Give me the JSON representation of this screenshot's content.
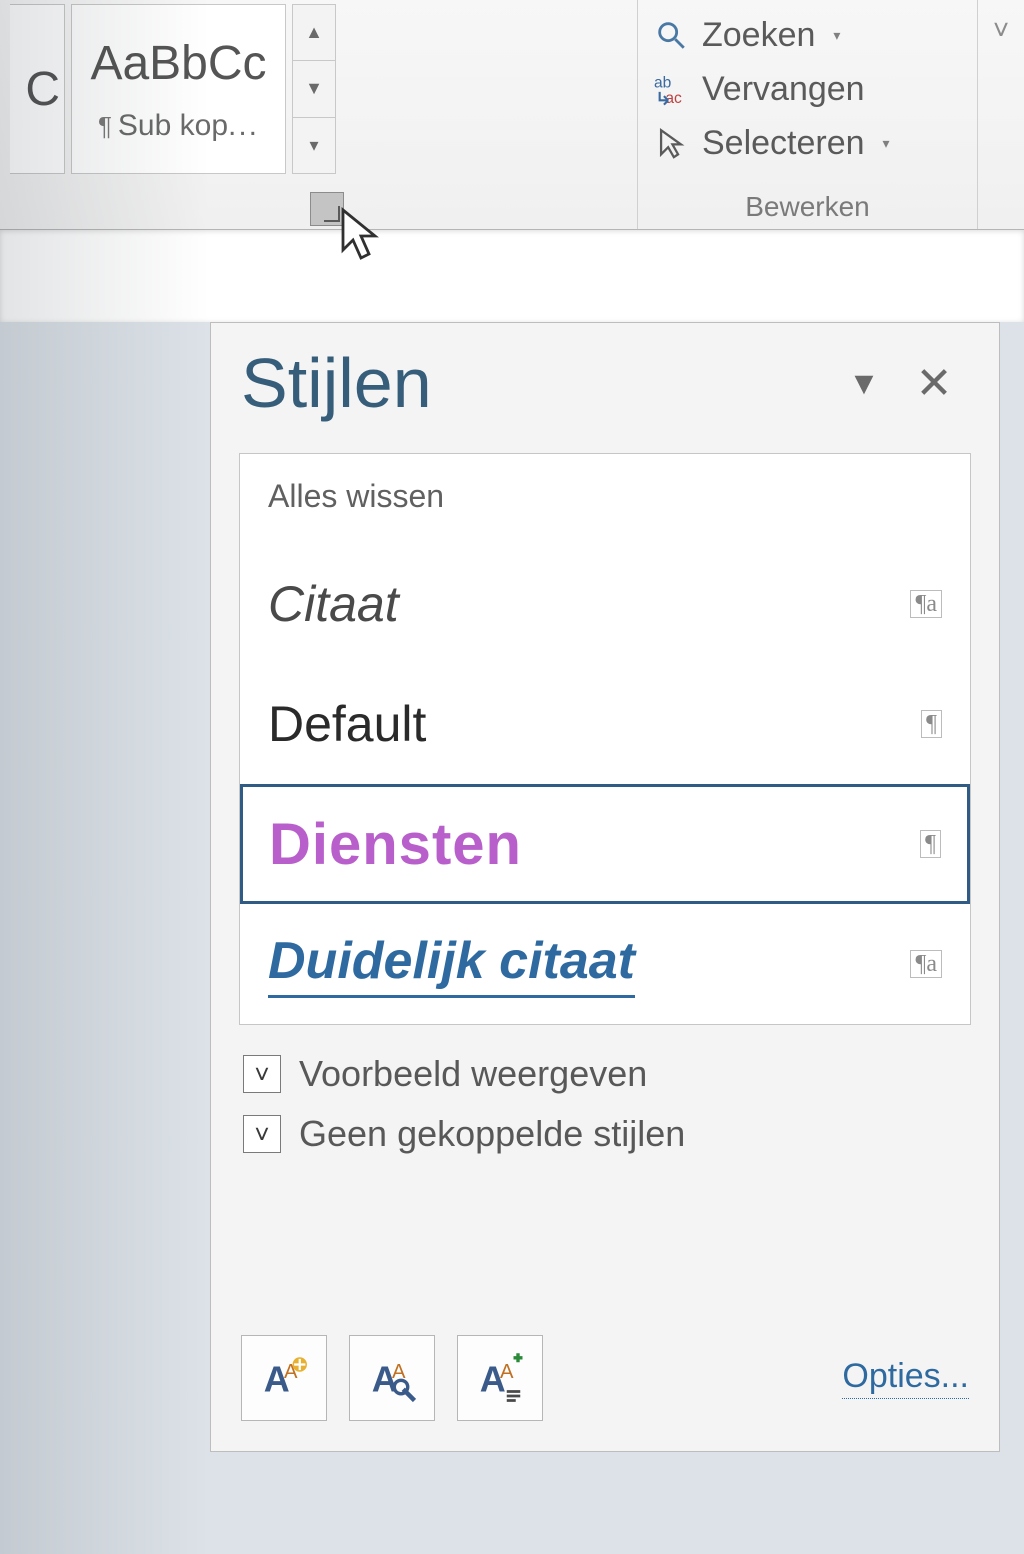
{
  "ribbon": {
    "gallery_preview_partial": "C",
    "gallery_preview_full": "AaBbCc",
    "gallery_style_label": "Sub kop",
    "gallery_ellipsis": "...",
    "editing": {
      "find": "Zoeken",
      "replace": "Vervangen",
      "select": "Selecteren",
      "caption": "Bewerken"
    }
  },
  "styles_pane": {
    "title": "Stijlen",
    "clear_all": "Alles wissen",
    "items": [
      {
        "name": "Citaat",
        "type_glyph": "¶a",
        "class": "citaat"
      },
      {
        "name": "Default",
        "type_glyph": "¶",
        "class": "default"
      },
      {
        "name": "Diensten",
        "type_glyph": "¶",
        "class": "diensten"
      },
      {
        "name": "Duidelijk citaat",
        "type_glyph": "¶a",
        "class": "duidelijk"
      }
    ],
    "checkbox_preview": "Voorbeeld weergeven",
    "checkbox_linked": "Geen gekoppelde stijlen",
    "options_link": "Opties..."
  }
}
